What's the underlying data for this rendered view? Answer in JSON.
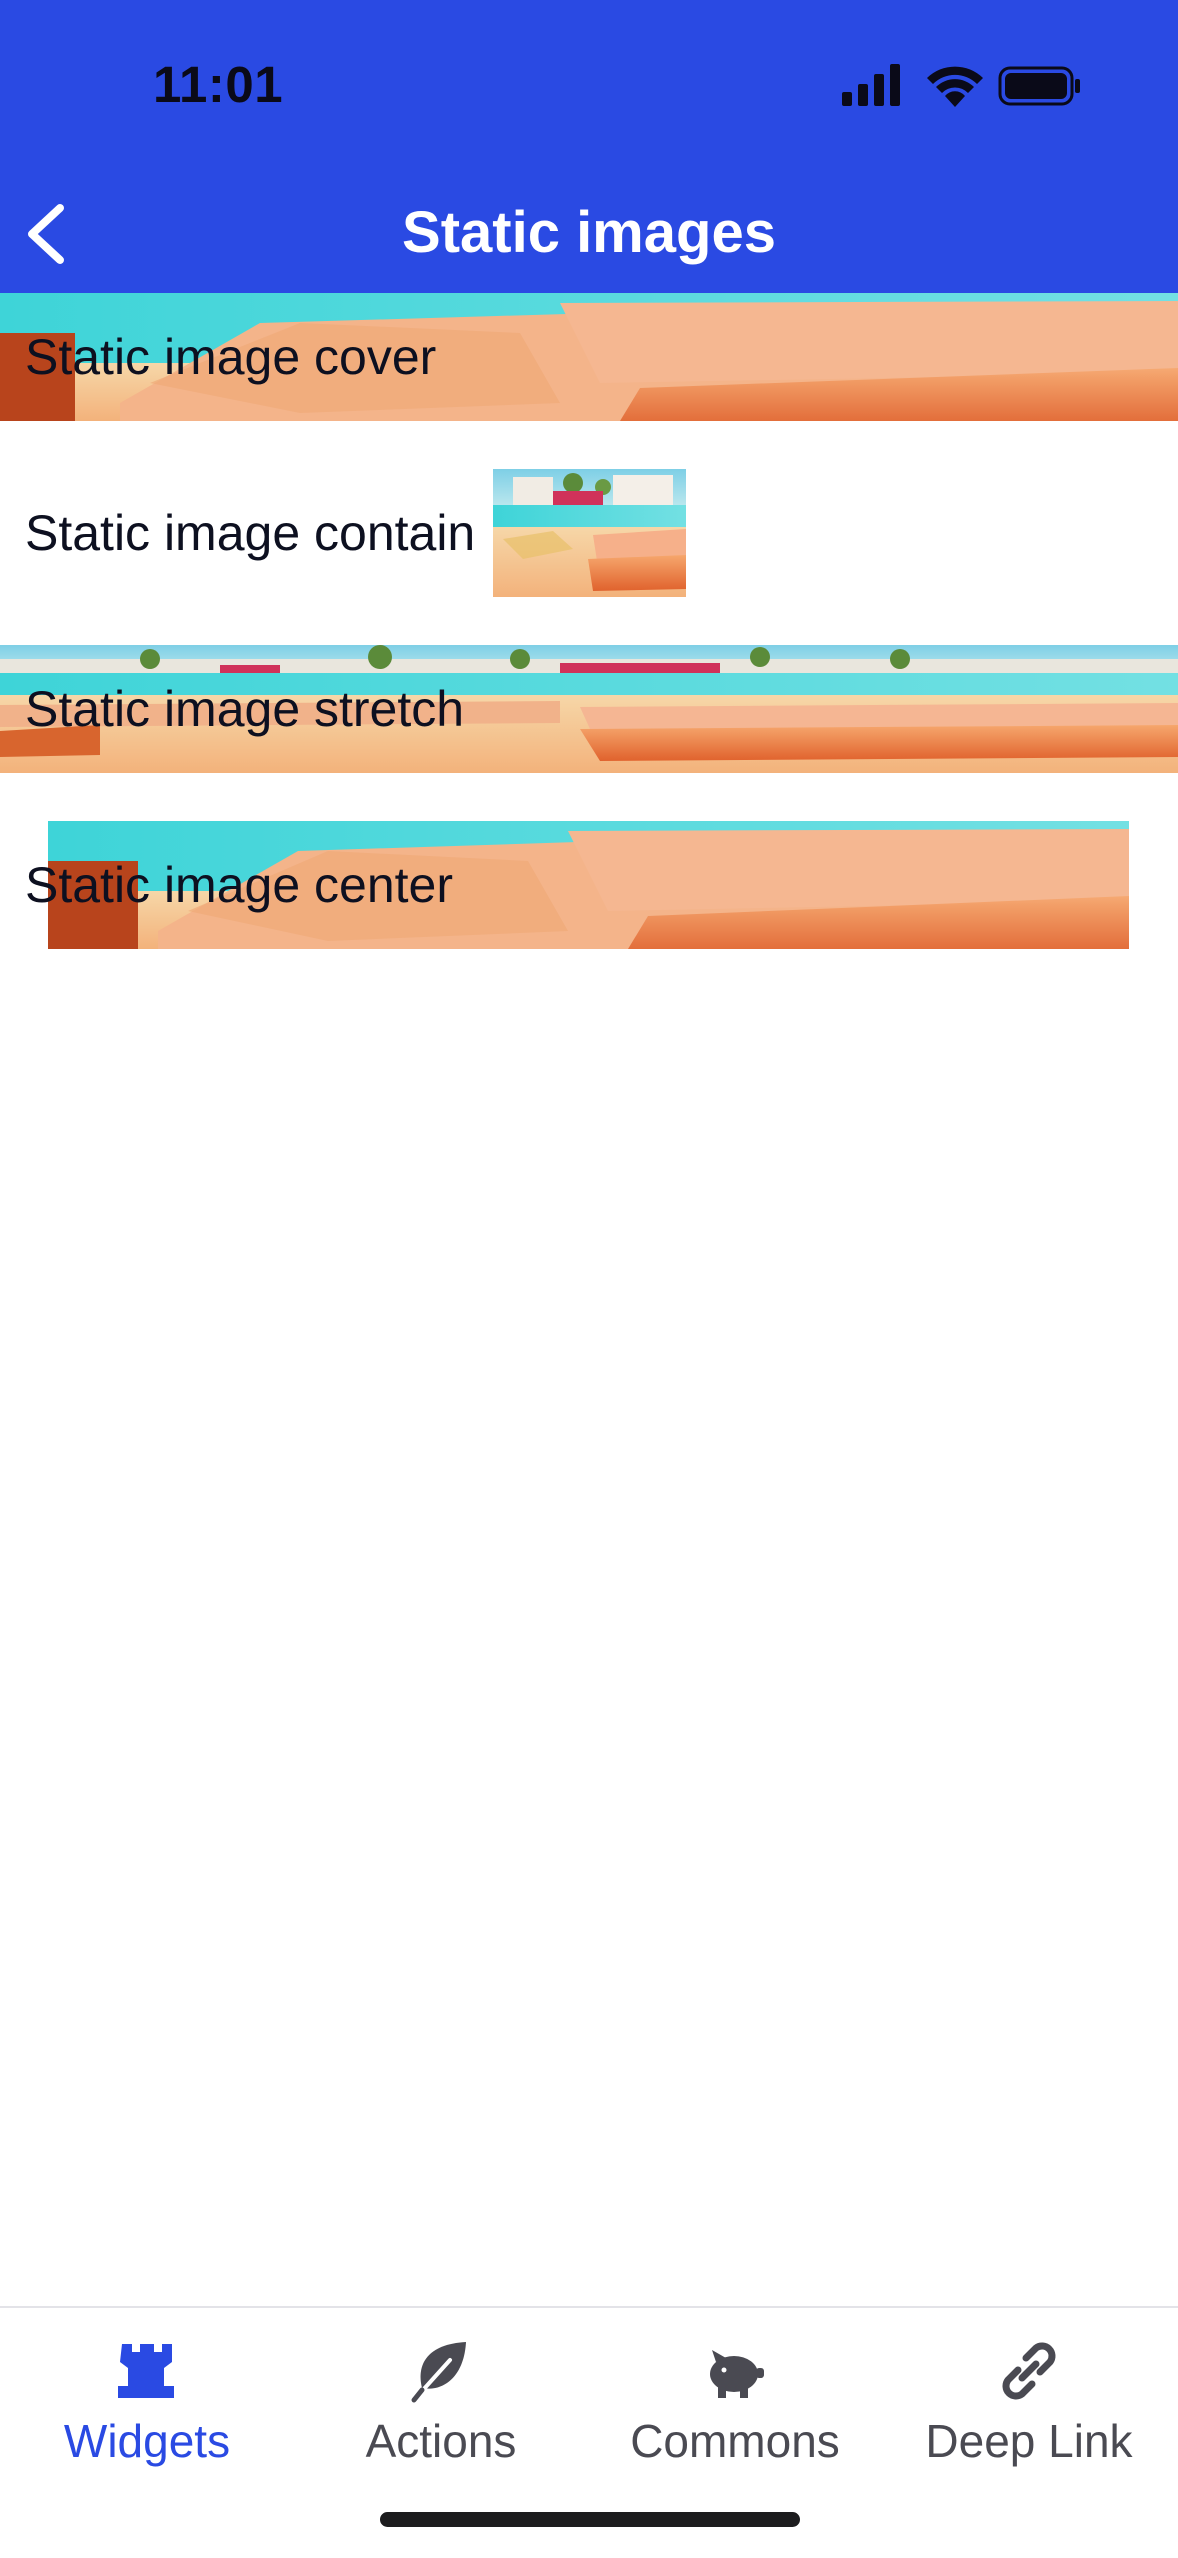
{
  "status_bar": {
    "time": "11:01"
  },
  "header": {
    "title": "Static images",
    "back_icon": "chevron-left-icon"
  },
  "rows": [
    {
      "label": "Static image cover"
    },
    {
      "label": "Static image contain"
    },
    {
      "label": "Static image stretch"
    },
    {
      "label": "Static image center"
    }
  ],
  "tabbar": {
    "active_index": 0,
    "tabs": [
      {
        "label": "Widgets",
        "icon": "rook-icon"
      },
      {
        "label": "Actions",
        "icon": "leaf-icon"
      },
      {
        "label": "Commons",
        "icon": "piggy-bank-icon"
      },
      {
        "label": "Deep Link",
        "icon": "link-icon"
      }
    ]
  },
  "colors": {
    "header_blue": "#2a4ae3",
    "active_tab": "#2a4ae3",
    "inactive_tab": "#4a4a52"
  }
}
